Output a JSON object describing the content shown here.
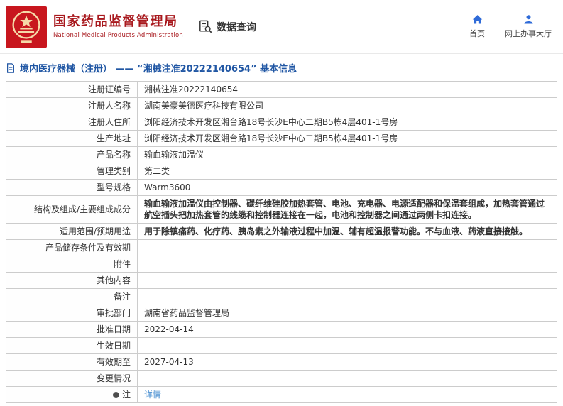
{
  "header": {
    "org_name_cn": "国家药品监督管理局",
    "org_name_en": "National Medical Products Administration",
    "nav": {
      "data_query": "数据查询",
      "home": "首页",
      "service_hall": "网上办事大厅"
    }
  },
  "breadcrumb": {
    "text": "境内医疗器械（注册） —— “湘械注准20222140654” 基本信息"
  },
  "table": {
    "rows": [
      {
        "label": "注册证编号",
        "value": "湘械注准20222140654"
      },
      {
        "label": "注册人名称",
        "value": "湖南美豪美德医疗科技有限公司"
      },
      {
        "label": "注册人住所",
        "value": "浏阳经济技术开发区湘台路18号长沙E中心二期B5栋4层401-1号房"
      },
      {
        "label": "生产地址",
        "value": "浏阳经济技术开发区湘台路18号长沙E中心二期B5栋4层401-1号房"
      },
      {
        "label": "产品名称",
        "value": "输血输液加温仪"
      },
      {
        "label": "管理类别",
        "value": "第二类"
      },
      {
        "label": "型号规格",
        "value": "Warm3600"
      },
      {
        "label": "结构及组成/主要组成成分",
        "value": "输血输液加温仪由控制器、碳纤维硅胶加热套管、电池、充电器、电源适配器和保温套组成，加热套管通过航空插头把加热套管的线缆和控制器连接在一起，电池和控制器之间通过两侧卡扣连接。"
      },
      {
        "label": "适用范围/预期用途",
        "value": "用于除镇痛药、化疗药、胰岛素之外输液过程中加温、辅有超温报警功能。不与血液、药液直接接触。"
      },
      {
        "label": "产品储存条件及有效期",
        "value": ""
      },
      {
        "label": "附件",
        "value": ""
      },
      {
        "label": "其他内容",
        "value": ""
      },
      {
        "label": "备注",
        "value": ""
      },
      {
        "label": "审批部门",
        "value": "湖南省药品监督管理局"
      },
      {
        "label": "批准日期",
        "value": "2022-04-14"
      },
      {
        "label": "生效日期",
        "value": ""
      },
      {
        "label": "有效期至",
        "value": "2027-04-13"
      },
      {
        "label": "变更情况",
        "value": ""
      },
      {
        "label": "注",
        "value": "详情"
      }
    ]
  },
  "colors": {
    "brand_red": "#a8181d",
    "logo_red": "#c8161e",
    "accent_blue": "#2157a4",
    "icon_blue": "#2f6bd8",
    "link_blue": "#4a90d2"
  }
}
